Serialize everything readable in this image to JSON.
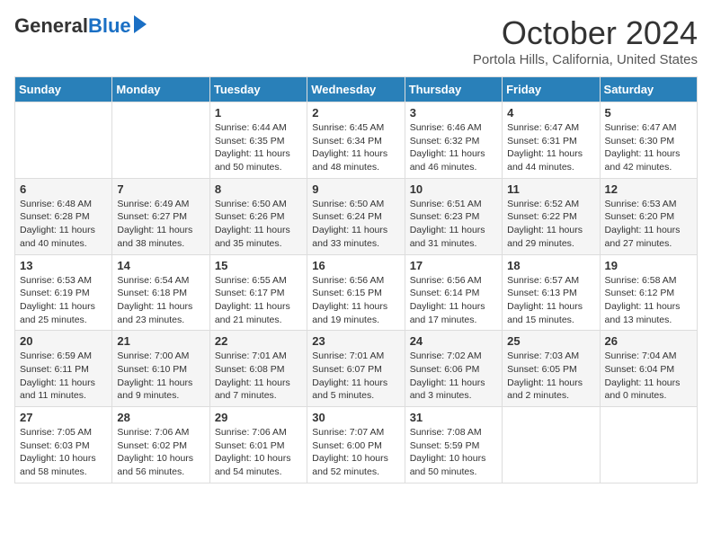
{
  "header": {
    "logo": {
      "general": "General",
      "blue": "Blue"
    },
    "title": "October 2024",
    "subtitle": "Portola Hills, California, United States"
  },
  "calendar": {
    "days": [
      "Sunday",
      "Monday",
      "Tuesday",
      "Wednesday",
      "Thursday",
      "Friday",
      "Saturday"
    ],
    "weeks": [
      [
        {
          "day": "",
          "info": ""
        },
        {
          "day": "",
          "info": ""
        },
        {
          "day": "1",
          "info": "Sunrise: 6:44 AM\nSunset: 6:35 PM\nDaylight: 11 hours and 50 minutes."
        },
        {
          "day": "2",
          "info": "Sunrise: 6:45 AM\nSunset: 6:34 PM\nDaylight: 11 hours and 48 minutes."
        },
        {
          "day": "3",
          "info": "Sunrise: 6:46 AM\nSunset: 6:32 PM\nDaylight: 11 hours and 46 minutes."
        },
        {
          "day": "4",
          "info": "Sunrise: 6:47 AM\nSunset: 6:31 PM\nDaylight: 11 hours and 44 minutes."
        },
        {
          "day": "5",
          "info": "Sunrise: 6:47 AM\nSunset: 6:30 PM\nDaylight: 11 hours and 42 minutes."
        }
      ],
      [
        {
          "day": "6",
          "info": "Sunrise: 6:48 AM\nSunset: 6:28 PM\nDaylight: 11 hours and 40 minutes."
        },
        {
          "day": "7",
          "info": "Sunrise: 6:49 AM\nSunset: 6:27 PM\nDaylight: 11 hours and 38 minutes."
        },
        {
          "day": "8",
          "info": "Sunrise: 6:50 AM\nSunset: 6:26 PM\nDaylight: 11 hours and 35 minutes."
        },
        {
          "day": "9",
          "info": "Sunrise: 6:50 AM\nSunset: 6:24 PM\nDaylight: 11 hours and 33 minutes."
        },
        {
          "day": "10",
          "info": "Sunrise: 6:51 AM\nSunset: 6:23 PM\nDaylight: 11 hours and 31 minutes."
        },
        {
          "day": "11",
          "info": "Sunrise: 6:52 AM\nSunset: 6:22 PM\nDaylight: 11 hours and 29 minutes."
        },
        {
          "day": "12",
          "info": "Sunrise: 6:53 AM\nSunset: 6:20 PM\nDaylight: 11 hours and 27 minutes."
        }
      ],
      [
        {
          "day": "13",
          "info": "Sunrise: 6:53 AM\nSunset: 6:19 PM\nDaylight: 11 hours and 25 minutes."
        },
        {
          "day": "14",
          "info": "Sunrise: 6:54 AM\nSunset: 6:18 PM\nDaylight: 11 hours and 23 minutes."
        },
        {
          "day": "15",
          "info": "Sunrise: 6:55 AM\nSunset: 6:17 PM\nDaylight: 11 hours and 21 minutes."
        },
        {
          "day": "16",
          "info": "Sunrise: 6:56 AM\nSunset: 6:15 PM\nDaylight: 11 hours and 19 minutes."
        },
        {
          "day": "17",
          "info": "Sunrise: 6:56 AM\nSunset: 6:14 PM\nDaylight: 11 hours and 17 minutes."
        },
        {
          "day": "18",
          "info": "Sunrise: 6:57 AM\nSunset: 6:13 PM\nDaylight: 11 hours and 15 minutes."
        },
        {
          "day": "19",
          "info": "Sunrise: 6:58 AM\nSunset: 6:12 PM\nDaylight: 11 hours and 13 minutes."
        }
      ],
      [
        {
          "day": "20",
          "info": "Sunrise: 6:59 AM\nSunset: 6:11 PM\nDaylight: 11 hours and 11 minutes."
        },
        {
          "day": "21",
          "info": "Sunrise: 7:00 AM\nSunset: 6:10 PM\nDaylight: 11 hours and 9 minutes."
        },
        {
          "day": "22",
          "info": "Sunrise: 7:01 AM\nSunset: 6:08 PM\nDaylight: 11 hours and 7 minutes."
        },
        {
          "day": "23",
          "info": "Sunrise: 7:01 AM\nSunset: 6:07 PM\nDaylight: 11 hours and 5 minutes."
        },
        {
          "day": "24",
          "info": "Sunrise: 7:02 AM\nSunset: 6:06 PM\nDaylight: 11 hours and 3 minutes."
        },
        {
          "day": "25",
          "info": "Sunrise: 7:03 AM\nSunset: 6:05 PM\nDaylight: 11 hours and 2 minutes."
        },
        {
          "day": "26",
          "info": "Sunrise: 7:04 AM\nSunset: 6:04 PM\nDaylight: 11 hours and 0 minutes."
        }
      ],
      [
        {
          "day": "27",
          "info": "Sunrise: 7:05 AM\nSunset: 6:03 PM\nDaylight: 10 hours and 58 minutes."
        },
        {
          "day": "28",
          "info": "Sunrise: 7:06 AM\nSunset: 6:02 PM\nDaylight: 10 hours and 56 minutes."
        },
        {
          "day": "29",
          "info": "Sunrise: 7:06 AM\nSunset: 6:01 PM\nDaylight: 10 hours and 54 minutes."
        },
        {
          "day": "30",
          "info": "Sunrise: 7:07 AM\nSunset: 6:00 PM\nDaylight: 10 hours and 52 minutes."
        },
        {
          "day": "31",
          "info": "Sunrise: 7:08 AM\nSunset: 5:59 PM\nDaylight: 10 hours and 50 minutes."
        },
        {
          "day": "",
          "info": ""
        },
        {
          "day": "",
          "info": ""
        }
      ]
    ]
  }
}
